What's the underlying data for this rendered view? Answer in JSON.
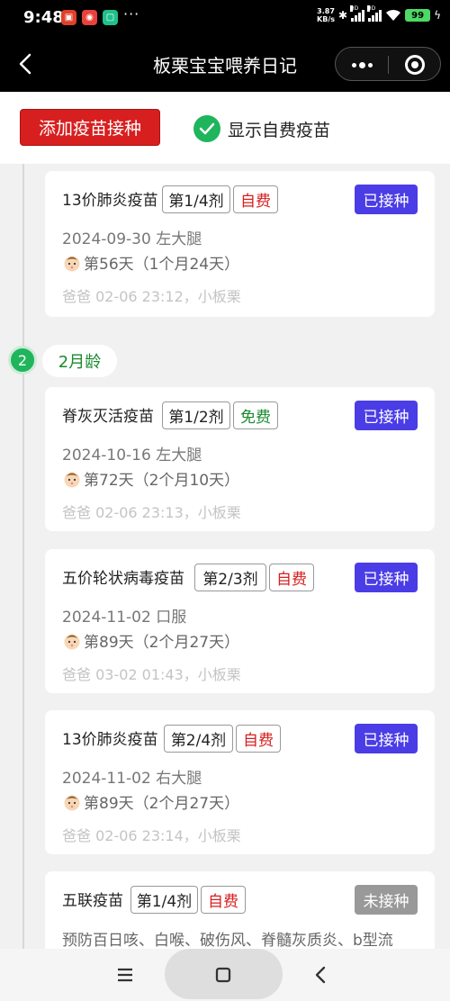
{
  "status_bar": {
    "time": "9:48",
    "app_icons": [
      {
        "name": "shopping-app-icon",
        "color": "#e0402a",
        "glyph": "▣"
      },
      {
        "name": "map-app-icon",
        "color": "#e8423a",
        "glyph": "◉"
      },
      {
        "name": "tv-app-icon",
        "color": "#1fc08a",
        "glyph": "▢"
      }
    ],
    "more": "···",
    "net_speed_value": "3.87",
    "net_speed_unit": "KB/s",
    "signal_label_1": "HD",
    "signal_label_2": "HD",
    "battery": "99"
  },
  "title_bar": {
    "title": "板栗宝宝喂养日记"
  },
  "toolbar": {
    "add_label": "添加疫苗接种",
    "show_self_paid_label": "显示自费疫苗",
    "show_self_paid_checked": true
  },
  "records": [
    {
      "vaccine": "13价肺炎疫苗",
      "dose": "第1/4剂",
      "fee": "自费",
      "status": "已接种",
      "date_site": "2024-09-30 左大腿",
      "age": "第56天（1个月24天）",
      "meta": "爸爸 02-06 23:12，小板栗"
    },
    {
      "vaccine": "脊灰灭活疫苗",
      "dose": "第1/2剂",
      "fee": "免费",
      "status": "已接种",
      "date_site": "2024-10-16 左大腿",
      "age": "第72天（2个月10天）",
      "meta": "爸爸 02-06 23:13，小板栗"
    },
    {
      "vaccine": "五价轮状病毒疫苗",
      "dose": "第2/3剂",
      "fee": "自费",
      "status": "已接种",
      "date_site": "2024-11-02 口服",
      "age": "第89天（2个月27天）",
      "meta": "爸爸 03-02 01:43，小板栗"
    },
    {
      "vaccine": "13价肺炎疫苗",
      "dose": "第2/4剂",
      "fee": "自费",
      "status": "已接种",
      "date_site": "2024-11-02 右大腿",
      "age": "第89天（2个月27天）",
      "meta": "爸爸 02-06 23:14，小板栗"
    },
    {
      "vaccine": "五联疫苗",
      "dose": "第1/4剂",
      "fee": "自费",
      "status": "未接种",
      "description": "预防百日咳、白喉、破伤风、脊髓灰质炎、b型流"
    }
  ],
  "month_group": {
    "number": "2",
    "label": "2月龄"
  },
  "colors": {
    "accent_red": "#d71f1f",
    "accent_green": "#1fb55c",
    "status_done": "#4a3de6",
    "status_todo": "#999999"
  }
}
